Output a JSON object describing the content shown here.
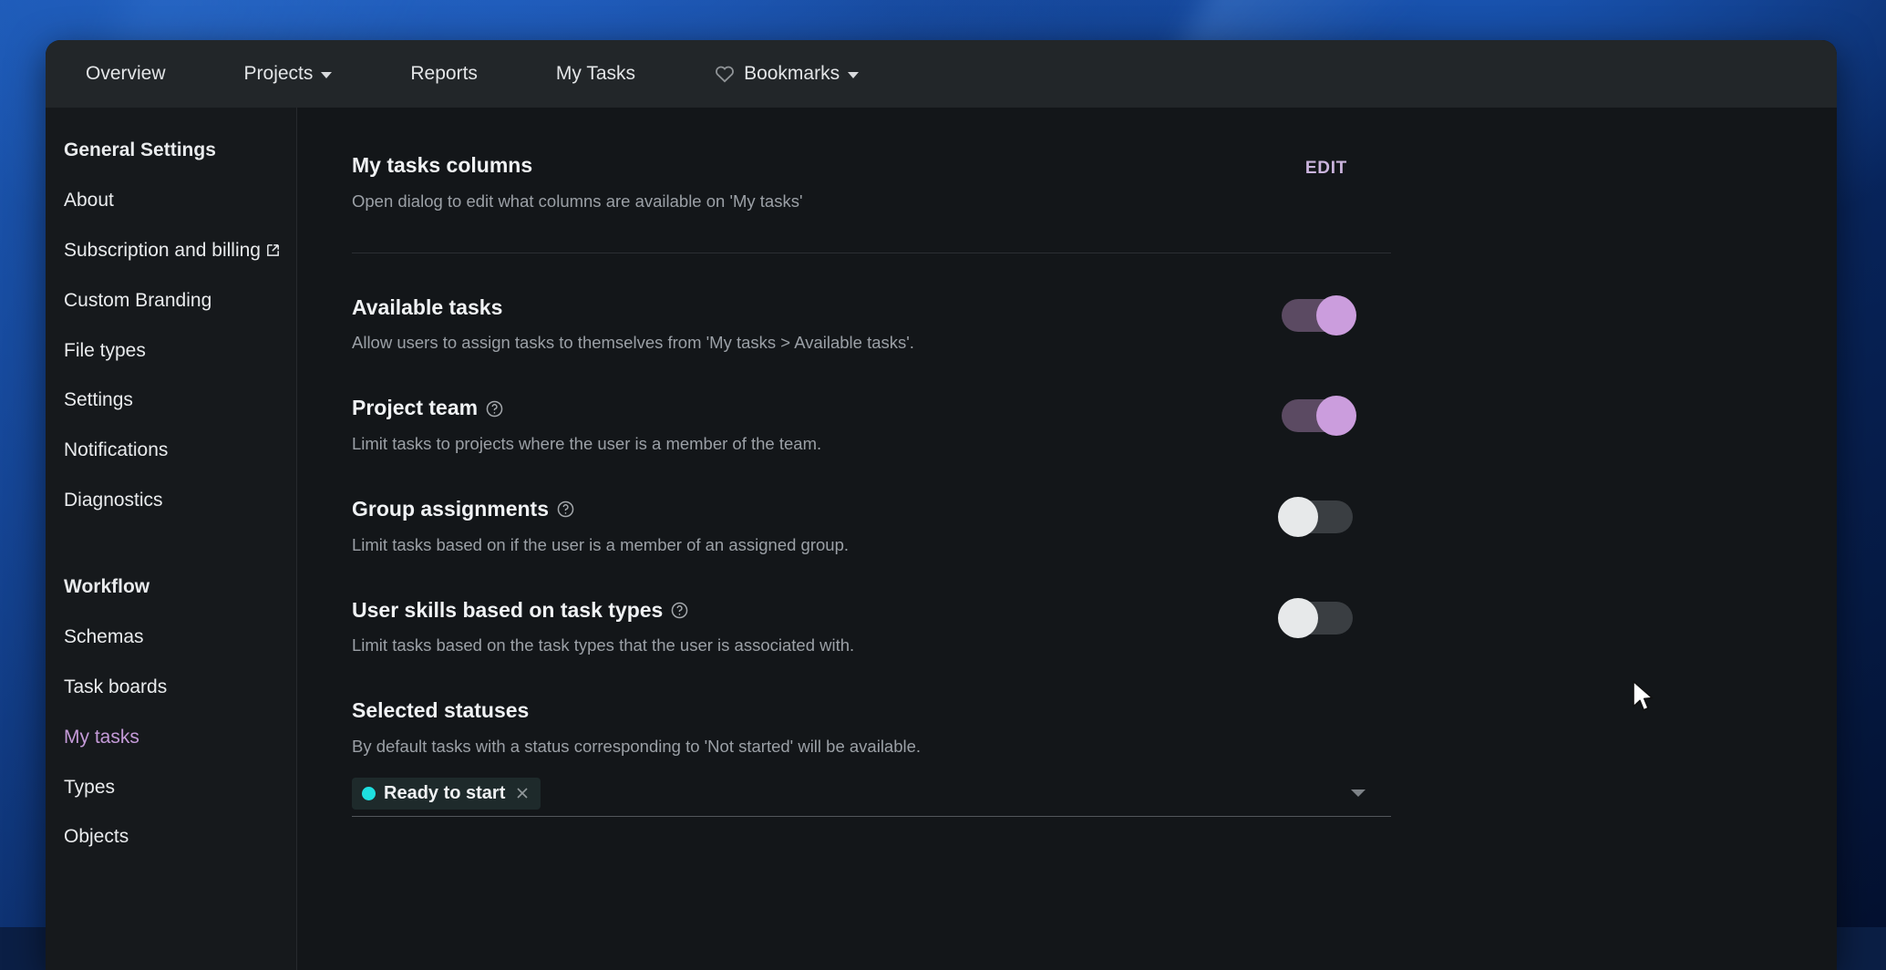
{
  "top_nav": {
    "items": [
      {
        "label": "Overview",
        "icon": null,
        "has_caret": false
      },
      {
        "label": "Projects",
        "icon": null,
        "has_caret": true
      },
      {
        "label": "Reports",
        "icon": null,
        "has_caret": false
      },
      {
        "label": "My Tasks",
        "icon": null,
        "has_caret": false
      },
      {
        "label": "Bookmarks",
        "icon": "heart-icon",
        "has_caret": true
      }
    ]
  },
  "sidebar": {
    "items": [
      {
        "label": "General Settings",
        "bold": true,
        "active": false,
        "external": false
      },
      {
        "label": "About",
        "bold": false,
        "active": false,
        "external": false
      },
      {
        "label": "Subscription and billing",
        "bold": false,
        "active": false,
        "external": true
      },
      {
        "label": "Custom Branding",
        "bold": false,
        "active": false,
        "external": false
      },
      {
        "label": "File types",
        "bold": false,
        "active": false,
        "external": false
      },
      {
        "label": "Settings",
        "bold": false,
        "active": false,
        "external": false
      },
      {
        "label": "Notifications",
        "bold": false,
        "active": false,
        "external": false
      },
      {
        "label": "Diagnostics",
        "bold": false,
        "active": false,
        "external": false
      },
      {
        "label": "Workflow",
        "bold": true,
        "active": false,
        "external": false
      },
      {
        "label": "Schemas",
        "bold": false,
        "active": false,
        "external": false
      },
      {
        "label": "Task boards",
        "bold": false,
        "active": false,
        "external": false
      },
      {
        "label": "My tasks",
        "bold": false,
        "active": true,
        "external": false
      },
      {
        "label": "Types",
        "bold": false,
        "active": false,
        "external": false
      },
      {
        "label": "Objects",
        "bold": false,
        "active": false,
        "external": false
      }
    ]
  },
  "main": {
    "settings": [
      {
        "title": "My tasks columns",
        "description": "Open dialog to edit what columns are available on 'My tasks'",
        "help": false,
        "control": "button",
        "button_label": "EDIT"
      },
      {
        "title": "Available tasks",
        "description": "Allow users to assign tasks to themselves from 'My tasks > Available tasks'.",
        "help": false,
        "control": "toggle",
        "toggle_state": "on"
      },
      {
        "title": "Project team",
        "description": "Limit tasks to projects where the user is a member of the team.",
        "help": true,
        "control": "toggle",
        "toggle_state": "on"
      },
      {
        "title": "Group assignments",
        "description": "Limit tasks based on if the user is a member of an assigned group.",
        "help": true,
        "control": "toggle",
        "toggle_state": "off"
      },
      {
        "title": "User skills based on task types",
        "description": "Limit tasks based on the task types that the user is associated with.",
        "help": true,
        "control": "toggle",
        "toggle_state": "off"
      }
    ],
    "selected_statuses": {
      "title": "Selected statuses",
      "description": "By default tasks with a status corresponding to 'Not started' will be available.",
      "chips": [
        {
          "label": "Ready to start",
          "dot_color": "#1ee0e0"
        }
      ]
    }
  },
  "colors": {
    "accent_purple": "#cb9ddd",
    "edit_link": "#cbb4dd",
    "active_nav": "#c49ad8",
    "window_bg": "#131619",
    "nav_bg": "#222629",
    "sidebar_bg": "#16191c",
    "chip_dot_cyan": "#1ee0e0"
  }
}
